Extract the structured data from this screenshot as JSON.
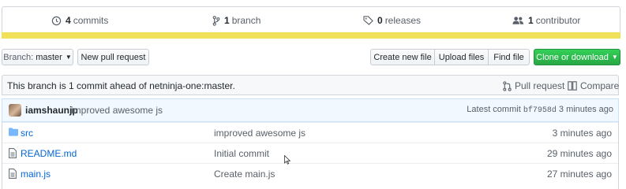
{
  "summary": {
    "commits": {
      "count": "4",
      "label": "commits",
      "icon": "history-icon"
    },
    "branches": {
      "count": "1",
      "label": "branch",
      "icon": "branch-icon"
    },
    "releases": {
      "count": "0",
      "label": "releases",
      "icon": "tag-icon"
    },
    "contributors": {
      "count": "1",
      "label": "contributor",
      "icon": "people-icon"
    },
    "language_color": "#f1e05a"
  },
  "toolbar": {
    "branch_prefix": "Branch:",
    "branch_name": "master",
    "new_pull_request": "New pull request",
    "create_new_file": "Create new file",
    "upload_files": "Upload files",
    "find_file": "Find file",
    "clone_or_download": "Clone or download"
  },
  "ahead_notice": {
    "message": "This branch is 1 commit ahead of netninja-one:master.",
    "pull_request": "Pull request",
    "compare": "Compare"
  },
  "latest_commit": {
    "author": "iamshaunjp",
    "message": "improved awesome js",
    "label": "Latest commit",
    "sha": "bf7958d",
    "age": "3 minutes ago"
  },
  "files": [
    {
      "type": "directory",
      "name": "src",
      "message": "improved awesome js",
      "age": "3 minutes ago"
    },
    {
      "type": "file",
      "name": "README.md",
      "message": "Initial commit",
      "age": "29 minutes ago"
    },
    {
      "type": "file",
      "name": "main.js",
      "message": "Create main.js",
      "age": "27 minutes ago"
    }
  ],
  "colors": {
    "link": "#0366d6",
    "green_button": "#28a745",
    "commit_bar": "#f1f8ff"
  }
}
